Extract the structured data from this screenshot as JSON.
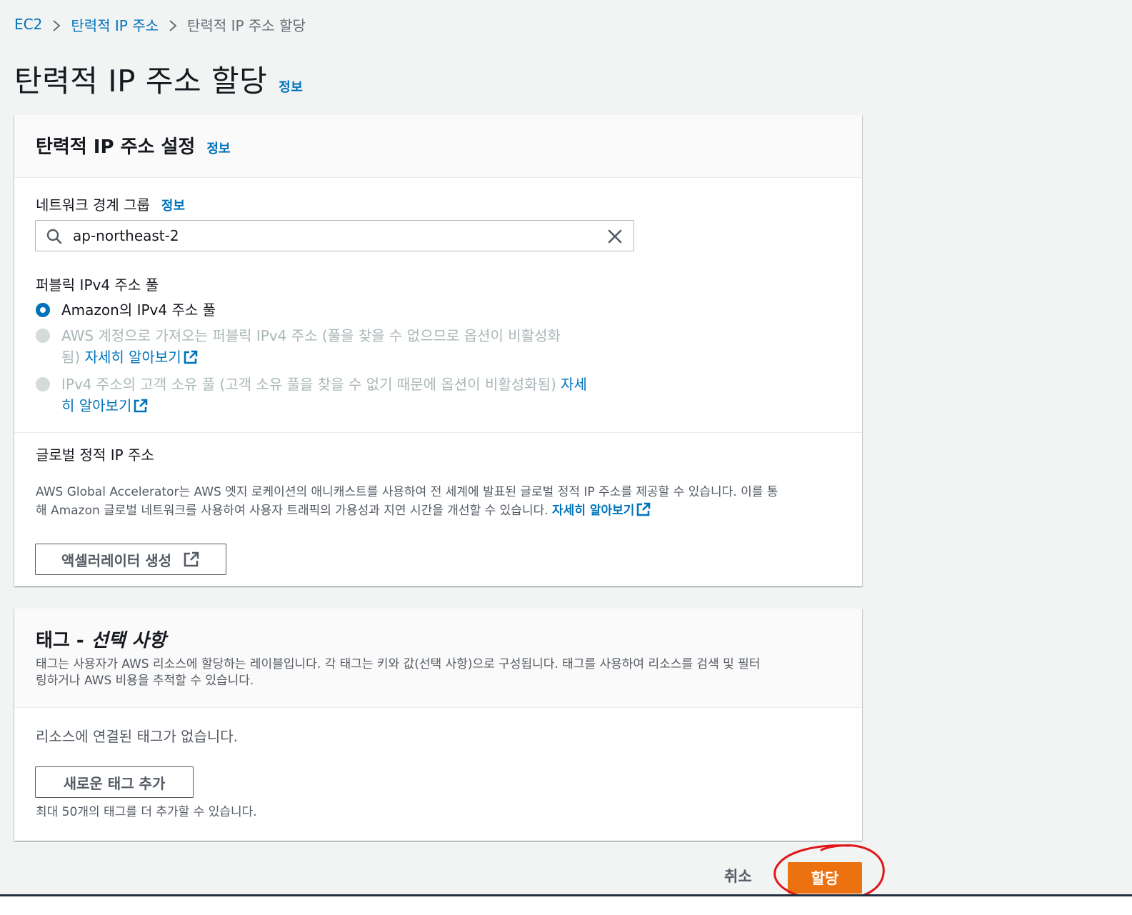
{
  "breadcrumb": {
    "items": [
      "EC2",
      "탄력적 IP 주소"
    ],
    "current": "탄력적 IP 주소 할당"
  },
  "page": {
    "title": "탄력적 IP 주소 할당",
    "info": "정보"
  },
  "settings": {
    "title": "탄력적 IP 주소 설정",
    "info": "정보",
    "network_group_label": "네트워크 경계 그룹",
    "network_group_info": "정보",
    "network_group_value": "ap-northeast-2",
    "pool_label": "퍼블릭 IPv4 주소 풀",
    "options": [
      {
        "label": "Amazon의 IPv4 주소 풀",
        "selected": true,
        "disabled": false
      },
      {
        "label_line1": "AWS 계정으로 가져오는 퍼블릭 IPv4 주소 (풀을 찾을 수 없으므로 옵션이 비활성화",
        "label_line2": "됨)",
        "link": "자세히 알아보기",
        "selected": false,
        "disabled": true
      },
      {
        "label_line1": "IPv4 주소의 고객 소유 풀 (고객 소유 풀을 찾을 수 없기 때문에 옵션이 비활성화됨)",
        "link_part1": "자세",
        "link_part2": "히 알아보기",
        "selected": false,
        "disabled": true
      }
    ],
    "global_label": "글로벌 정적 IP 주소",
    "global_desc_line1": "AWS Global Accelerator는 AWS 엣지 로케이션의 애니캐스트를 사용하여 전 세계에 발표된 글로벌 정적 IP 주소를 제공할 수 있습니다. 이를 통",
    "global_desc_line2": "해 Amazon 글로벌 네트워크를 사용하여 사용자 트래픽의 가용성과 지연 시간을 개선할 수 있습니다.",
    "global_link": "자세히 알아보기",
    "create_accelerator_label": "액셀러레이터 생성"
  },
  "tags": {
    "title_prefix": "태그 -",
    "title_optional": "선택 사항",
    "desc_line1": "태그는 사용자가 AWS 리소스에 할당하는 레이블입니다. 각 태그는 키와 값(선택 사항)으로 구성됩니다. 태그를 사용하여 리소스를 검색 및 필터",
    "desc_line2": "링하거나 AWS 비용을 추적할 수 있습니다.",
    "empty_text": "리소스에 연결된 태그가 없습니다.",
    "add_button": "새로운 태그 추가",
    "limit_text": "최대 50개의 태그를 더 추가할 수 있습니다."
  },
  "footer": {
    "cancel": "취소",
    "submit": "할당"
  },
  "colors": {
    "link": "#0073bb",
    "primary_button": "#ec7211",
    "annotation": "#e0181b"
  }
}
